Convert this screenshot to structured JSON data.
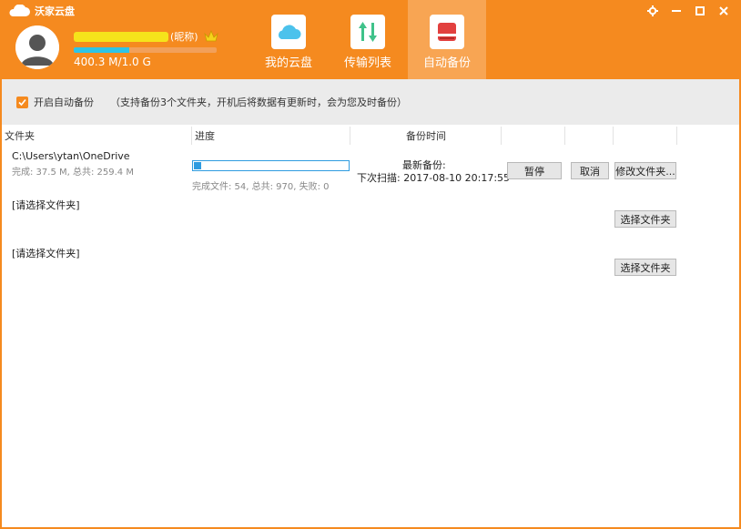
{
  "app": {
    "title": "沃家云盘",
    "window_controls": [
      "gear-icon",
      "minimize-icon",
      "maximize-icon",
      "close-icon"
    ]
  },
  "user": {
    "nickname": "(昵称)",
    "quota_text": "400.3 M/1.0 G",
    "quota_fraction": 0.39
  },
  "nav": {
    "tabs": [
      {
        "label": "我的云盘",
        "icon": "cloud-icon"
      },
      {
        "label": "传输列表",
        "icon": "transfer-arrows-icon"
      },
      {
        "label": "自动备份",
        "icon": "backup-drive-icon"
      }
    ],
    "active_index": 2
  },
  "auto_backup": {
    "enable_label": "开启自动备份",
    "enabled": true,
    "hint": "（支持备份3个文件夹，开机后将数据有更新时，会为您及时备份）"
  },
  "columns": {
    "folder": "文件夹",
    "progress": "进度",
    "backup_time": "备份时间"
  },
  "rows": [
    {
      "path": "C:\\Users\\ytan\\OneDrive",
      "size": "完成: 37.5 M, 总共: 259.4 M",
      "progress_fraction": 0.05,
      "progress_text": "完成文件: 54, 总共: 970, 失败: 0",
      "last_backup": "最新备份:",
      "next_scan": "下次扫描: 2017-08-10 20:17:55",
      "pause_label": "暂停",
      "cancel_label": "取消",
      "modify_label": "修改文件夹..."
    },
    {
      "placeholder": "[请选择文件夹]",
      "select_label": "选择文件夹"
    },
    {
      "placeholder": "[请选择文件夹]",
      "select_label": "选择文件夹"
    }
  ],
  "colors": {
    "brand_orange": "#f58a1f",
    "active_tab": "#f8a553",
    "progress_blue": "#2f9ce0",
    "quota_cyan": "#2ec4e6"
  }
}
